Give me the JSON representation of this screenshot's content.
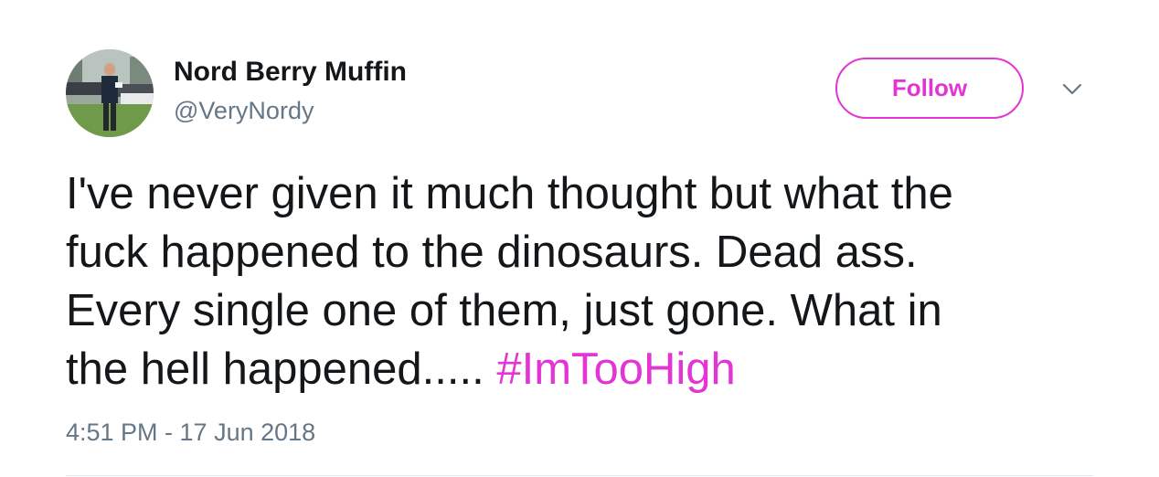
{
  "user": {
    "display_name": "Nord Berry Muffin",
    "handle": "@VeryNordy"
  },
  "follow_button": {
    "label": "Follow"
  },
  "menu": {
    "icon": "chevron-down-icon"
  },
  "tweet": {
    "lines": [
      "I've never given it much thought but what the",
      "fuck happened to the dinosaurs. Dead ass.",
      "Every single one of them, just gone. What in",
      "the hell happened..... "
    ],
    "hashtag": "#ImTooHigh",
    "timestamp": "4:51 PM - 17 Jun 2018"
  },
  "colors": {
    "accent": "#e235d4",
    "text": "#14171a",
    "secondary": "#657786",
    "divider": "#e1e8ed"
  }
}
